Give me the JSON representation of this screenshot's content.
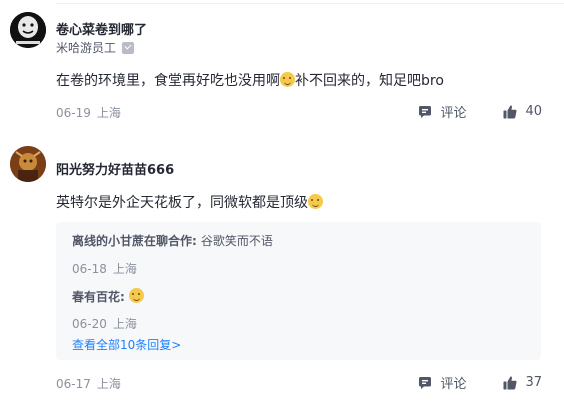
{
  "comments": [
    {
      "username": "卷心菜卷到哪了",
      "title": "米哈游员工",
      "text": "在卷的环境里，食堂再好吃也没用啊",
      "text_after_emoji": "补不回来的，知足吧bro",
      "date": "06-19",
      "location": "上海",
      "comment_label": "评论",
      "likes": "40"
    },
    {
      "username": "阳光努力好苗苗666",
      "text": "英特尔是外企天花板了，同微软都是顶级",
      "date": "06-17",
      "location": "上海",
      "comment_label": "评论",
      "likes": "37",
      "replies": [
        {
          "username": "离线的小甘蔗在聊合作:",
          "text": "谷歌笑而不语",
          "date": "06-18",
          "location": "上海"
        },
        {
          "username": "春有百花:",
          "text": "",
          "date": "06-20",
          "location": "上海"
        }
      ],
      "more_replies": "查看全部10条回复>"
    }
  ],
  "colors": {
    "text": "#252933",
    "secondary": "#8a919f",
    "link": "#1e80ff",
    "reply_bg": "#f7f8fa"
  },
  "icons": [
    "comment-icon",
    "thumbs-up-icon",
    "verified-icon",
    "emoji-icon"
  ]
}
